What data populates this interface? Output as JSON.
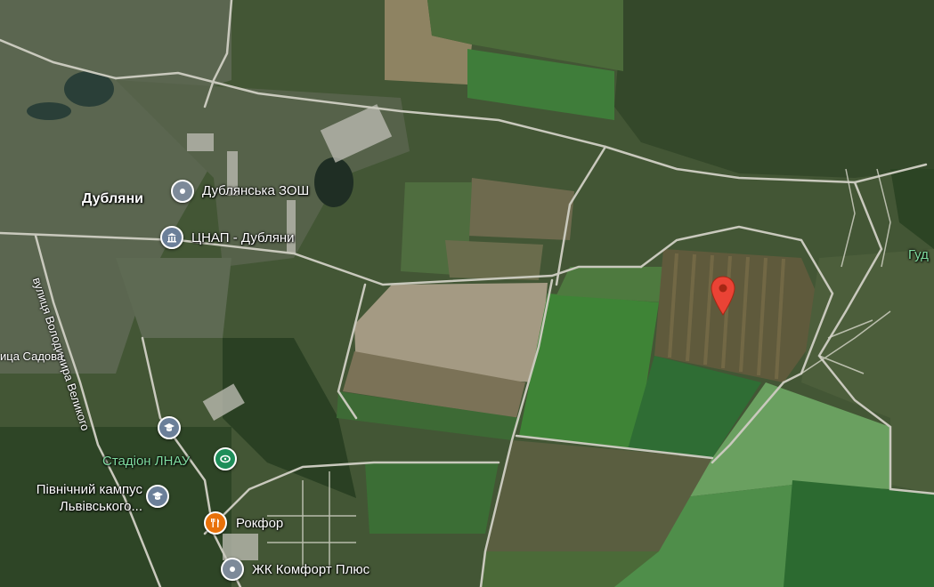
{
  "map": {
    "place_labels": {
      "town": "Дубляни",
      "school": "Дублянська ЗОШ",
      "admin_center": "ЦНАП - Дубляни",
      "stadium": "Стадіон ЛНАУ",
      "campus_line1": "Північний кампус",
      "campus_line2": "Львівського...",
      "restaurant": "Рокфор",
      "residential": "ЖК Комфорт Плюс",
      "edge_label": "Гуд"
    },
    "street_labels": {
      "volodymyra": "вулиця Володимира Великого",
      "sadova": "ица Садова"
    },
    "colors": {
      "pin_red": "#ea4335",
      "poi_gray": "#7d8a99",
      "poi_green": "#1e8e5a",
      "poi_orange": "#e8710a",
      "poi_blue_gray": "#6b7f99"
    },
    "icons": {
      "school": "pin-icon",
      "admin_center": "government-icon",
      "stadium": "stadium-icon",
      "campus": "graduation-cap-icon",
      "campus_pin": "graduation-cap-icon",
      "restaurant": "fork-knife-icon",
      "residential": "pin-icon",
      "dropped_pin": "map-marker-icon"
    }
  }
}
